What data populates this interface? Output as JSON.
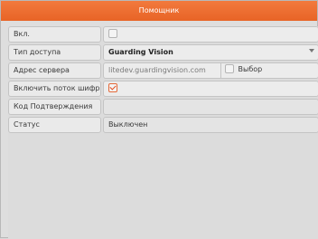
{
  "window": {
    "title": "Помощник"
  },
  "rows": [
    {
      "label": "Вкл.",
      "checkbox": false
    },
    {
      "label": "Тип доступа",
      "value": "Guarding Vision"
    },
    {
      "label": "Адрес сервера",
      "value": "litedev.guardingvision.com",
      "choice_label": "Выбор",
      "choice_checked": false
    },
    {
      "label": "Включить поток шифров...",
      "checkbox": true
    },
    {
      "label": "Код Подтверждения",
      "value": ""
    },
    {
      "label": "Статус",
      "value": "Выключен"
    }
  ],
  "colors": {
    "title_bar": "#e86426",
    "check_mark": "#e24a1a"
  }
}
